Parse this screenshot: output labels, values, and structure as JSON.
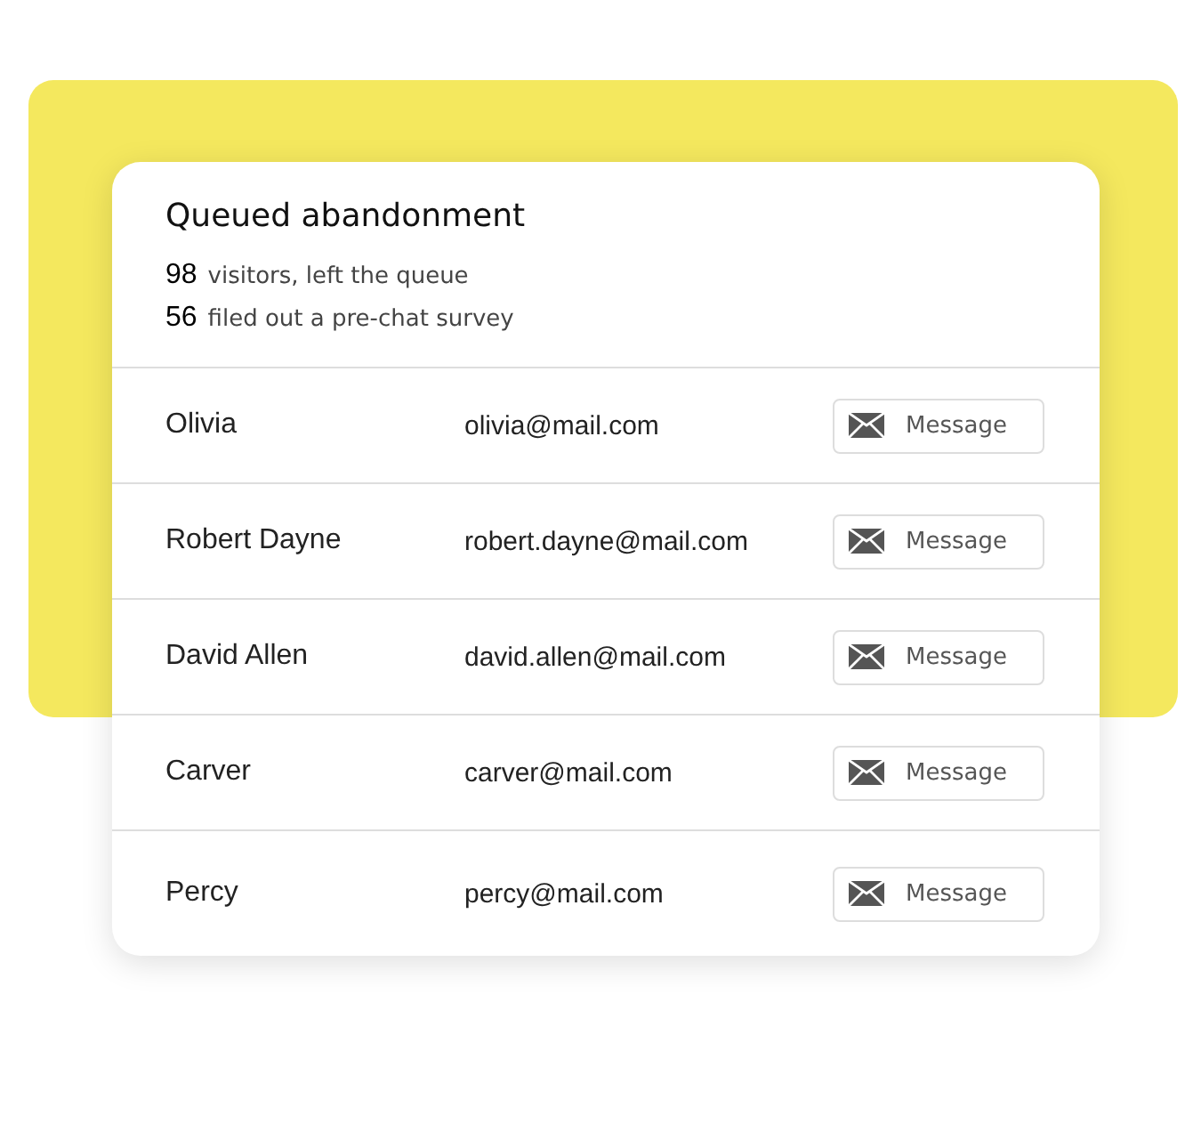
{
  "card": {
    "title": "Queued abandonment",
    "stats": [
      {
        "count": "98",
        "label": "visitors, left the queue"
      },
      {
        "count": "56",
        "label": "filed out a pre-chat survey"
      }
    ],
    "rows": [
      {
        "name": "Olivia",
        "email": "olivia@mail.com",
        "action": "Message"
      },
      {
        "name": "Robert Dayne",
        "email": "robert.dayne@mail.com",
        "action": "Message"
      },
      {
        "name": "David Allen",
        "email": "david.allen@mail.com",
        "action": "Message"
      },
      {
        "name": "Carver",
        "email": "carver@mail.com",
        "action": "Message"
      },
      {
        "name": "Percy",
        "email": "percy@mail.com",
        "action": "Message"
      }
    ]
  }
}
